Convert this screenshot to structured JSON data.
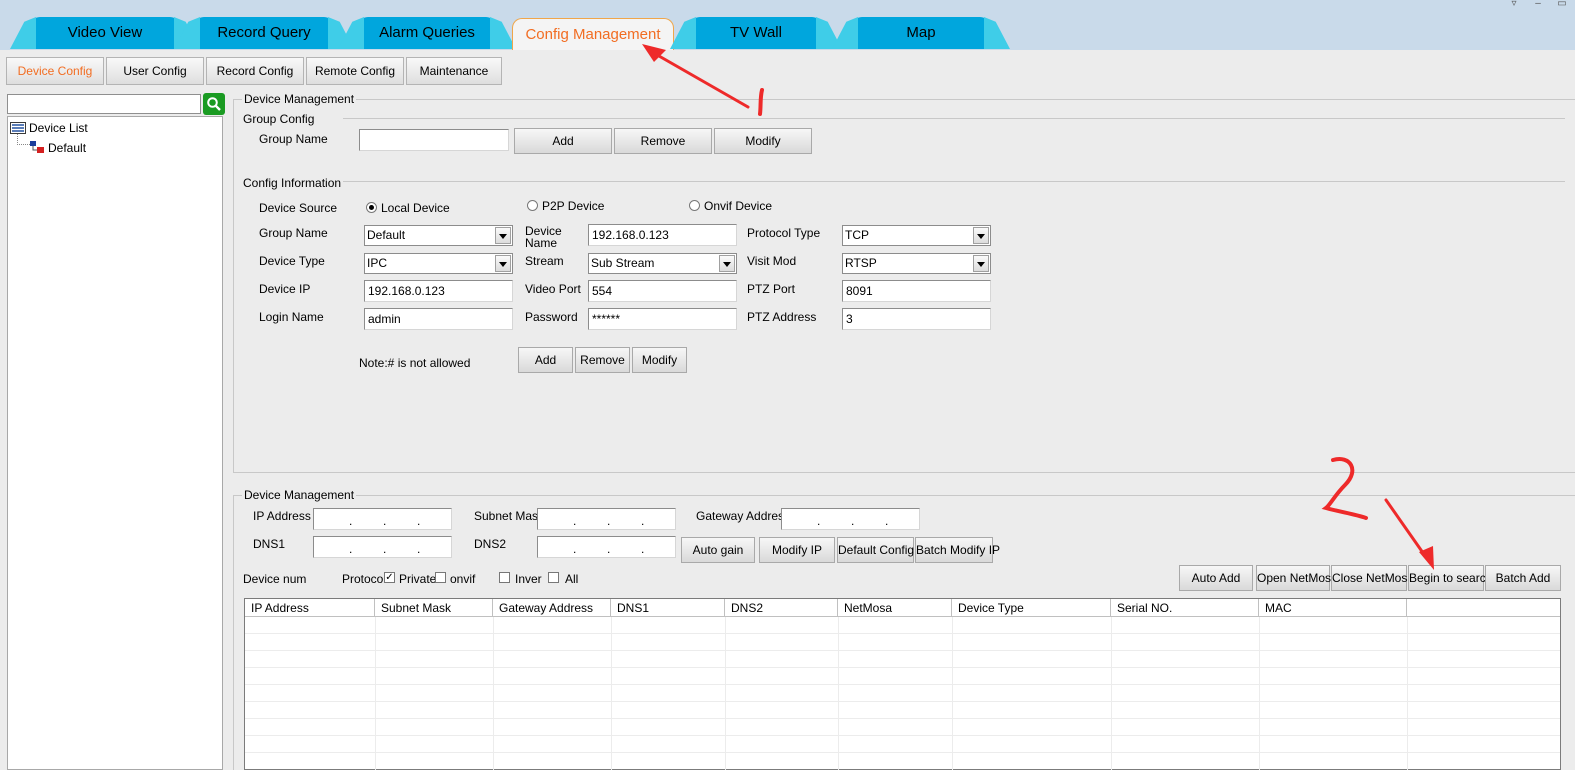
{
  "main_tabs": [
    "Video View",
    "Record Query",
    "Alarm Queries",
    "Config Management",
    "TV Wall",
    "Map"
  ],
  "active_main_tab": "Config Management",
  "sub_tabs": [
    "Device Config",
    "User Config",
    "Record Config",
    "Remote Config",
    "Maintenance"
  ],
  "active_sub_tab": "Device Config",
  "tree": {
    "root": "Device List",
    "children": [
      "Default"
    ]
  },
  "device_management": {
    "title": "Device Management",
    "group_config": {
      "title": "Group Config",
      "group_name_label": "Group Name",
      "group_name_value": "",
      "buttons": [
        "Add",
        "Remove",
        "Modify"
      ]
    },
    "config_info": {
      "title": "Config Information",
      "device_source_label": "Device Source",
      "sources": [
        "Local Device",
        "P2P Device",
        "Onvif Device"
      ],
      "selected_source": "Local Device",
      "group_name_label": "Group Name",
      "group_name_value": "Default",
      "device_name_label_1": "Device",
      "device_name_label_2": "Name",
      "device_name_value": "192.168.0.123",
      "protocol_type_label": "Protocol Type",
      "protocol_type_value": "TCP",
      "device_type_label": "Device Type",
      "device_type_value": "IPC",
      "stream_label": "Stream",
      "stream_value": "Sub Stream",
      "visit_mod_label": "Visit Mod",
      "visit_mod_value": "RTSP",
      "device_ip_label": "Device IP",
      "device_ip_value": "192.168.0.123",
      "video_port_label": "Video Port",
      "video_port_value": "554",
      "ptz_port_label": "PTZ Port",
      "ptz_port_value": "8091",
      "login_name_label": "Login Name",
      "login_name_value": "admin",
      "password_label": "Password",
      "password_value": "******",
      "ptz_address_label": "PTZ Address",
      "ptz_address_value": "3",
      "note": "Note:# is not allowed",
      "buttons": [
        "Add",
        "Remove",
        "Modify"
      ]
    }
  },
  "network": {
    "title": "Device Management",
    "ip_address_label": "IP Address",
    "subnet_mask_label": "Subnet Mask",
    "gateway_label": "Gateway Address",
    "dns1_label": "DNS1",
    "dns2_label": "DNS2",
    "buttons": [
      "Auto gain",
      "Modify IP",
      "Default Config",
      "Batch Modify IP"
    ],
    "device_num_label": "Device num",
    "protocol_label": "Protocol",
    "checks": [
      {
        "label": "Private",
        "checked": true
      },
      {
        "label": "onvif",
        "checked": false
      },
      {
        "label": "Inver",
        "checked": false
      },
      {
        "label": "All",
        "checked": false
      }
    ],
    "action_buttons": [
      "Auto Add",
      "Open NetMosa",
      "Close NetMosa",
      "Begin to search",
      "Batch Add"
    ]
  },
  "table": {
    "columns": [
      "IP Address",
      "Subnet Mask",
      "Gateway Address",
      "DNS1",
      "DNS2",
      "NetMosa",
      "Device Type",
      "Serial NO.",
      "MAC"
    ],
    "rows": []
  },
  "annotations": [
    "1",
    "2"
  ],
  "colors": {
    "tab_blue": "#00a6dd",
    "active_orange": "#f26d22",
    "annotation_red": "#ee2a2a",
    "header_bg": "#c9daea"
  }
}
